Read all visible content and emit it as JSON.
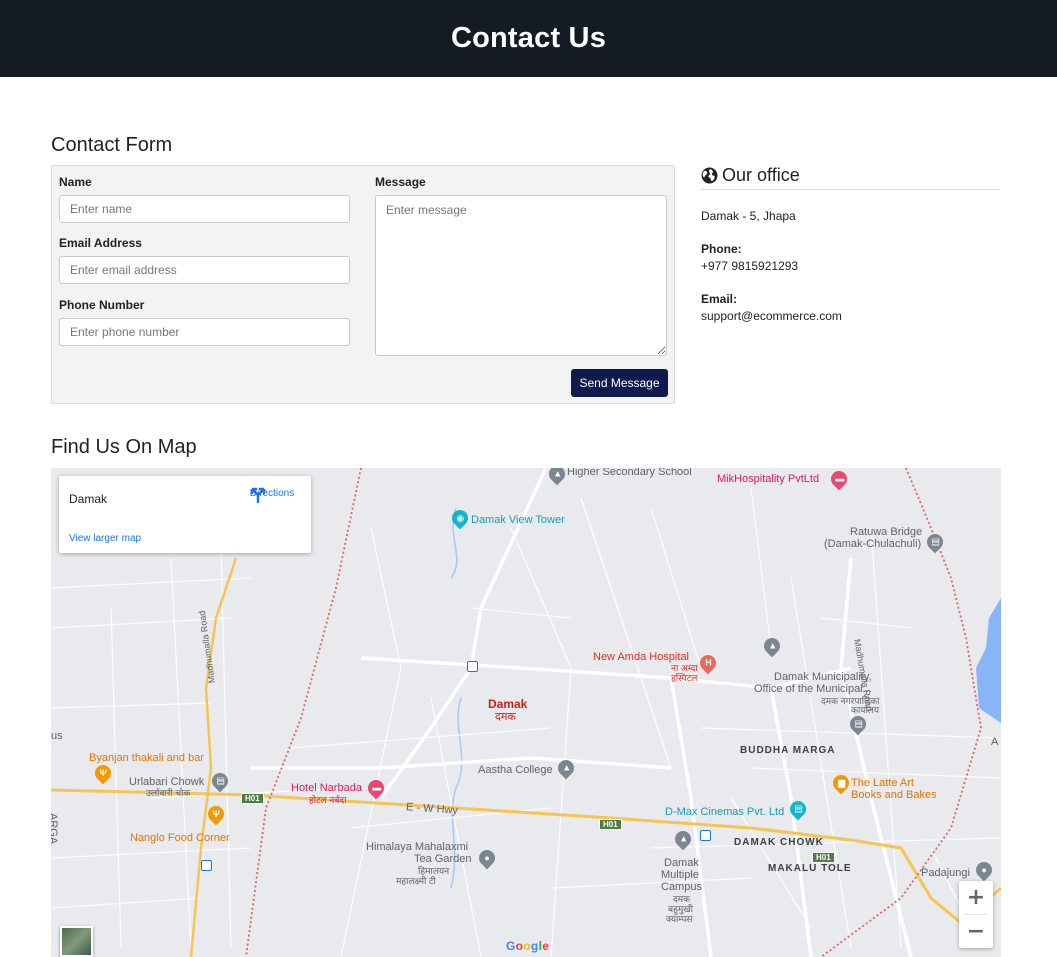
{
  "header": {
    "title": "Contact Us"
  },
  "contact_form": {
    "title": "Contact Form",
    "name_label": "Name",
    "name_placeholder": "Enter name",
    "email_label": "Email Address",
    "email_placeholder": "Enter email address",
    "phone_label": "Phone Number",
    "phone_placeholder": "Enter phone number",
    "message_label": "Message",
    "message_placeholder": "Enter message",
    "send_label": "Send Message",
    "send_color": "#101a4f"
  },
  "office": {
    "icon": "globe-icon",
    "title": "Our office",
    "address": "Damak - 5, Jhapa",
    "phone_label": "Phone:",
    "phone": "+977 9815921293",
    "email_label": "Email:",
    "email": "support@ecommerce.com"
  },
  "map": {
    "title": "Find Us On Map",
    "place": "Damak",
    "directions": "Directions",
    "view_larger": "View larger map",
    "zoom_in": "+",
    "zoom_out": "−",
    "labels": {
      "higher_secondary": "Higher Secondary School",
      "mikhospitality": "MikHospitality PvtLtd",
      "damak_view_tower": "Damak View Tower",
      "ratuwa_bridge_1": "Ratuwa Bridge",
      "ratuwa_bridge_2": "(Damak-Chulachuli)",
      "new_amda_1": "New Amda Hospital",
      "new_amda_2": "ना अम्दा",
      "new_amda_3": "हस्पिटल",
      "damak_municipality_1": "Damak Municipality,",
      "damak_municipality_2": "Office of the Municipal...",
      "damak_municipality_3": "दमक नगरपालिका",
      "damak_municipality_4": "कार्यालय",
      "damak_town": "Damak",
      "damak_town_np": "दमक",
      "buddha_marga": "BUDDHA MARGA",
      "aastha_college": "Aastha College",
      "byanjan_1": "Byanjan thakali and bar",
      "urlabari_chowk_1": "Urlabari Chowk",
      "urlabari_chowk_2": "उर्लाबारी चोक",
      "hotel_narbada_1": "Hotel Narbada",
      "hotel_narbada_2": "होटल नर्बदा",
      "latte_art_1": "The Latte Art",
      "latte_art_2": "Books and Bakes",
      "dmax": "D-Max Cinemas Pvt. Ltd",
      "ew_hwy": "E - W Hwy",
      "nanglo": "Nanglo Food Corner",
      "damak_chowk": "DAMAK CHOWK",
      "himalaya_1": "Himalaya Mahalaxmi",
      "himalaya_2": "Tea Garden",
      "himalaya_3": "हिमालयन",
      "himalaya_4": "महालक्ष्मी टी",
      "damak_campus_1": "Damak",
      "damak_campus_2": "Multiple",
      "damak_campus_3": "Campus",
      "damak_campus_4": "दमक",
      "damak_campus_5": "बहुमुखी",
      "damak_campus_6": "क्याम्पस",
      "makalu_tole": "MAKALU TOLE",
      "padajungi": "Padajungi",
      "madhumalla_road": "Madhumalla Road",
      "madhumalla_road_2": "Madhumalla Road",
      "us": "us",
      "arga": "ARGA",
      "a_edge": "A",
      "h01_1": "H01",
      "h01_2": "H01",
      "h01_3": "H01"
    },
    "google": [
      "G",
      "o",
      "o",
      "g",
      "l",
      "e"
    ]
  }
}
